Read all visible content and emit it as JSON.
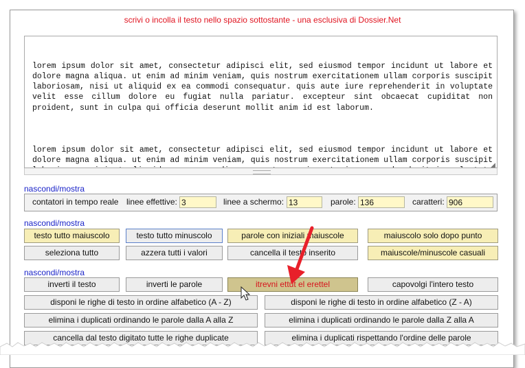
{
  "header": {
    "title": "scrivi o incolla il testo nello spazio sottostante - una esclusiva di Dossier.Net"
  },
  "editor": {
    "paragraphs": [
      "lorem ipsum dolor sit amet, consectetur adipisci elit, sed eiusmod tempor incidunt ut labore et dolore magna aliqua. ut enim ad minim veniam, quis nostrum exercitationem ullam corporis suscipit laboriosam, nisi ut aliquid ex ea commodi consequatur. quis aute iure reprehenderit in voluptate velit esse cillum dolore eu fugiat nulla pariatur. excepteur sint obcaecat cupiditat non proident, sunt in culpa qui officia deserunt mollit anim id est laborum.",
      "lorem ipsum dolor sit amet, consectetur adipisci elit, sed eiusmod tempor incidunt ut labore et dolore magna aliqua. ut enim ad minim veniam, quis nostrum exercitationem ullam corporis suscipit laboriosam, nisi ut aliquid ex ea commodi consequatur. quis aute iure reprehenderit in voluptate velit esse cillum dolore eu fugiat nulla pariatur. excepteur sint obcaecat cupiditat non proident, sunt in culpa qui officia deserunt mollit anim id est laborum."
    ]
  },
  "counters": {
    "toggle_label": "nascondi/mostra",
    "realtime_button": "contatori in tempo reale",
    "effective_lines_label": "linee effettive:",
    "effective_lines_value": "3",
    "screen_lines_label": "linee a schermo:",
    "screen_lines_value": "13",
    "words_label": "parole:",
    "words_value": "136",
    "chars_label": "caratteri:",
    "chars_value": "906"
  },
  "case_section": {
    "toggle_label": "nascondi/mostra",
    "buttons": [
      "testo tutto maiuscolo",
      "testo tutto minuscolo",
      "parole con iniziali maiuscole",
      "maiuscolo solo dopo punto",
      "seleziona tutto",
      "azzera tutti i valori",
      "cancella il testo inserito",
      "maiuscole/minuscole casuali"
    ]
  },
  "transform_section": {
    "toggle_label": "nascondi/mostra",
    "buttons": [
      "inverti il testo",
      "inverti le parole",
      "itrevni ettut el erettel",
      "capovolgi l'intero testo",
      "disponi le righe di testo in ordine alfabetico (A - Z)",
      "disponi le righe di testo in ordine alfabetico (Z - A)",
      "elimina i duplicati ordinando le parole dalla A alla Z",
      "elimina i duplicati ordinando le parole dalla Z alla A",
      "cancella dal testo digitato tutte le righe duplicate",
      "elimina i duplicati rispettando l'ordine delle parole"
    ]
  },
  "colors": {
    "title_red": "#e0131f",
    "link_blue": "#1a23c8",
    "button_yellow": "#f7eeb6",
    "input_yellow": "#fff8c8",
    "annotation_arrow": "#e8202a"
  }
}
